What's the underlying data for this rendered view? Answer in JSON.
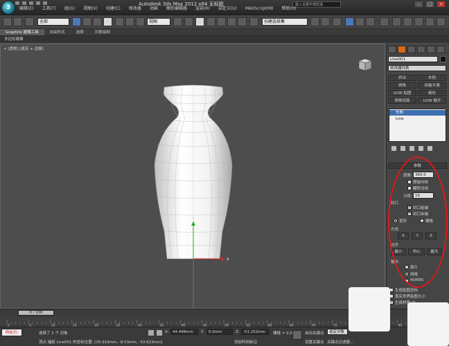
{
  "title_bar": {
    "app_title": "Autodesk 3ds Max  2012 x64    无标题",
    "search_placeholder": "键入关键字或短语",
    "menus": [
      "编辑(E)",
      "工具(T)",
      "组(G)",
      "视图(V)",
      "创建(C)",
      "修改器",
      "动画",
      "图形编辑器",
      "渲染(R)",
      "自定义(U)",
      "MAXScript(M)",
      "帮助(H)"
    ]
  },
  "toolbar": {
    "selection_filter": "全部",
    "reference_coord": "视图",
    "named_selection_placeholder": "创建选择集"
  },
  "ribbon": {
    "tabs": [
      "Graphite 建模工具",
      "自由形式",
      "选择",
      "对象绘制"
    ],
    "panel_label": "多边形建模"
  },
  "viewport": {
    "label": "+ [透视] [真实 + 边面]"
  },
  "command_panel": {
    "object_name": "Line001",
    "modifier_list": "修改器列表",
    "buttons": [
      "挤出",
      "车削",
      "倒角",
      "网格平滑",
      "UVW 贴图",
      "细化",
      "倒角剖面",
      "UVW 展开"
    ],
    "stack": [
      {
        "label": "车削",
        "selected": true
      },
      {
        "label": "Line",
        "selected": false
      }
    ],
    "params_title": "参数",
    "degrees_label": "度数:",
    "degrees_value": "360.0",
    "weld_core": "焊接内核",
    "flip_normals": "翻转法线",
    "segments_label": "分段:",
    "segments_value": "16",
    "capping_title": "封口",
    "cap_start": "封口始端",
    "cap_end": "封口末端",
    "morph": "变形",
    "grid": "栅格",
    "direction_title": "方向",
    "direction_buttons": [
      "X",
      "Y",
      "Z"
    ],
    "align_title": "对齐",
    "align_buttons": [
      "最小",
      "中心",
      "最大"
    ],
    "output_title": "输出",
    "output_options": [
      "面片",
      "网格",
      "NURBS"
    ],
    "gen_mapping": "生成贴图坐标",
    "real_world": "真实世界贴图大小",
    "gen_material": "生成材质 ID"
  },
  "timeline": {
    "frame_slider": "0 / 100",
    "ticks": [
      "0",
      "5",
      "10",
      "15",
      "20",
      "25",
      "30",
      "35",
      "40",
      "45",
      "50",
      "55",
      "60",
      "65",
      "70",
      "75",
      "80",
      "85",
      "90",
      "95",
      "100"
    ]
  },
  "status_bar": {
    "mode_badge": "所在行:",
    "selection_status": "选择了 1 个 对象",
    "prompt": "顶点 捕捉 Line001 的坐标位置: [35.919mm, -8.53mm, -53.623mm]",
    "x_value": "44.448mm",
    "y_value": "0.0mm",
    "z_value": "-51.252mm",
    "grid_label": "栅格 = 0.0mm",
    "auto_key": "自动关键点",
    "selected_obj": "选定对象",
    "set_key": "设置关键点",
    "key_filters": "关键点过滤器...",
    "add_time_tag": "添加时间标记"
  },
  "colors": {
    "accent": "#d86a1a",
    "selection": "#4a79b8",
    "annotation": "#e01818"
  }
}
